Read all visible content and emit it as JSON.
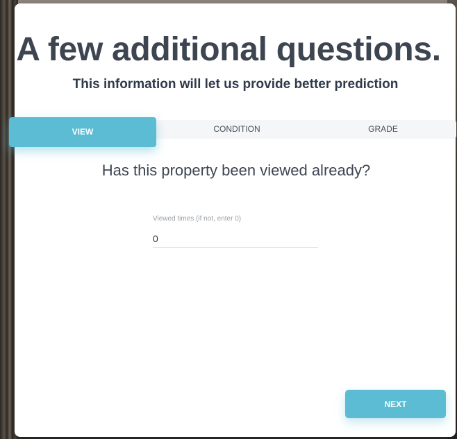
{
  "header": {
    "title": "A few additional questions.",
    "subtitle": "This information will let us provide better prediction"
  },
  "tabs": [
    {
      "label": "VIEW",
      "active": true
    },
    {
      "label": "CONDITION",
      "active": false
    },
    {
      "label": "GRADE",
      "active": false
    }
  ],
  "form": {
    "question": "Has this property been viewed already?",
    "viewed_label": "Viewed times (if not, enter 0)",
    "viewed_value": "0"
  },
  "actions": {
    "next_label": "NEXT"
  },
  "colors": {
    "accent": "#5bbcd3",
    "heading": "#3d4551"
  }
}
